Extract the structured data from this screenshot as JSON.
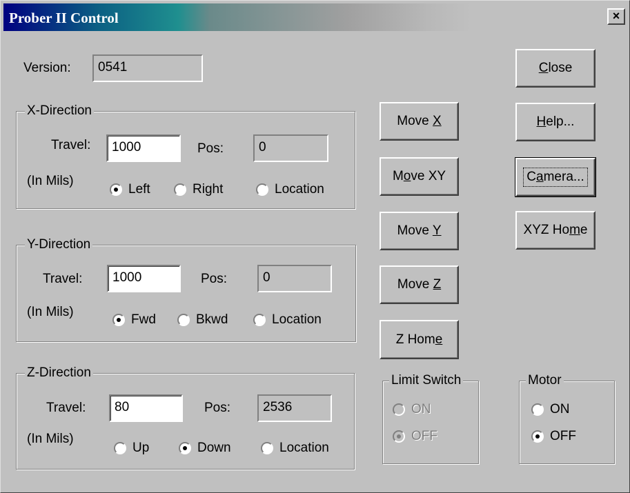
{
  "window": {
    "title": "Prober II Control",
    "close_glyph": "×"
  },
  "version": {
    "label": "Version:",
    "value": "0541"
  },
  "x_direction": {
    "title": "X-Direction",
    "travel_label": "Travel:",
    "travel_value": "1000",
    "pos_label": "Pos:",
    "pos_value": "0",
    "units_label": "(In Mils)",
    "options": [
      {
        "label": "Left",
        "selected": true
      },
      {
        "label": "Right",
        "selected": false
      },
      {
        "label": "Location",
        "selected": false
      }
    ]
  },
  "y_direction": {
    "title": "Y-Direction",
    "travel_label": "Travel:",
    "travel_value": "1000",
    "pos_label": "Pos:",
    "pos_value": "0",
    "units_label": "(In Mils)",
    "options": [
      {
        "label": "Fwd",
        "selected": true
      },
      {
        "label": "Bkwd",
        "selected": false
      },
      {
        "label": "Location",
        "selected": false
      }
    ]
  },
  "z_direction": {
    "title": "Z-Direction",
    "travel_label": "Travel:",
    "travel_value": "80",
    "pos_label": "Pos:",
    "pos_value": "2536",
    "units_label": "(In Mils)",
    "options": [
      {
        "label": "Up",
        "selected": false
      },
      {
        "label": "Down",
        "selected": true
      },
      {
        "label": "Location",
        "selected": false
      }
    ]
  },
  "move_buttons": {
    "move_x": {
      "pre": "Move ",
      "accel": "X",
      "post": ""
    },
    "move_xy": {
      "pre": "M",
      "accel": "o",
      "post": "ve XY"
    },
    "move_y": {
      "pre": "Move ",
      "accel": "Y",
      "post": ""
    },
    "move_z": {
      "pre": "Move ",
      "accel": "Z",
      "post": ""
    },
    "z_home": {
      "pre": "Z Hom",
      "accel": "e",
      "post": ""
    }
  },
  "side_buttons": {
    "close": {
      "pre": "",
      "accel": "C",
      "post": "lose"
    },
    "help": {
      "pre": "",
      "accel": "H",
      "post": "elp..."
    },
    "camera": {
      "pre": "C",
      "accel": "a",
      "post": "mera..."
    },
    "xyz_home": {
      "pre": "XYZ Ho",
      "accel": "m",
      "post": "e"
    }
  },
  "limit_switch": {
    "title": "Limit Switch",
    "options": [
      {
        "label": "ON",
        "selected": false
      },
      {
        "label": "OFF",
        "selected": true
      }
    ]
  },
  "motor": {
    "title": "Motor",
    "options": [
      {
        "label": "ON",
        "selected": false
      },
      {
        "label": "OFF",
        "selected": true
      }
    ]
  }
}
